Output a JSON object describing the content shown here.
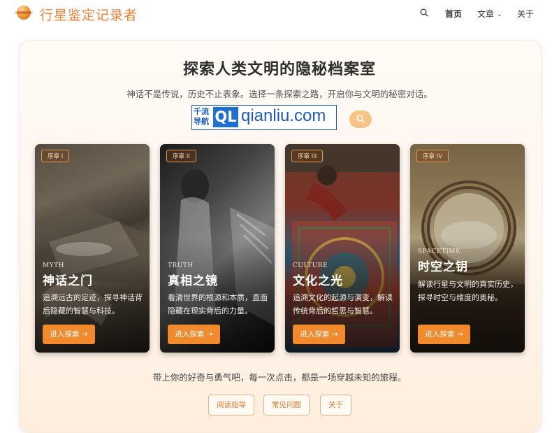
{
  "header": {
    "title": "行星鉴定记录者",
    "nav": {
      "home": "首页",
      "articles": "文章",
      "about": "关于"
    }
  },
  "hero": {
    "title": "探索人类文明的隐秘档案室",
    "subtitle": "神话不是传说，历史不止表象。选择一条探索之路，开启你与文明的秘密对话。"
  },
  "ad": {
    "cn_line1": "千流",
    "cn_line2": "导航",
    "badge": "QL",
    "domain": "qianliu.com"
  },
  "cards": [
    {
      "chapter": "序章 I",
      "en": "MYTH",
      "title": "神话之门",
      "desc": "追溯远古的足迹，探寻神话背后隐藏的智慧与科技。",
      "button": "进入探索 →"
    },
    {
      "chapter": "序章 II",
      "en": "TRUTH",
      "title": "真相之镜",
      "desc": "看清世界的根源和本质，直面隐藏在现实背后的力量。",
      "button": "进入探索 →"
    },
    {
      "chapter": "序章 III",
      "en": "CULTURE",
      "title": "文化之光",
      "desc": "追溯文化的起源与演变，解读传统背后的哲思与智慧。",
      "button": "进入探索 →"
    },
    {
      "chapter": "序章 IV",
      "en": "SPACETIME",
      "title": "时空之钥",
      "desc": "解读行星与文明的真实历史，探寻时空与维度的奥秘。",
      "button": "进入探索 →"
    }
  ],
  "footer": {
    "tagline": "带上你的好奇与勇气吧，每一次点击，都是一场穿越未知的旅程。",
    "links": [
      "阅读指导",
      "常见问题",
      "关于"
    ]
  },
  "colors": {
    "brand": "#e8833a",
    "button": "#f08a2c",
    "ad_blue": "#1f5bb5"
  }
}
